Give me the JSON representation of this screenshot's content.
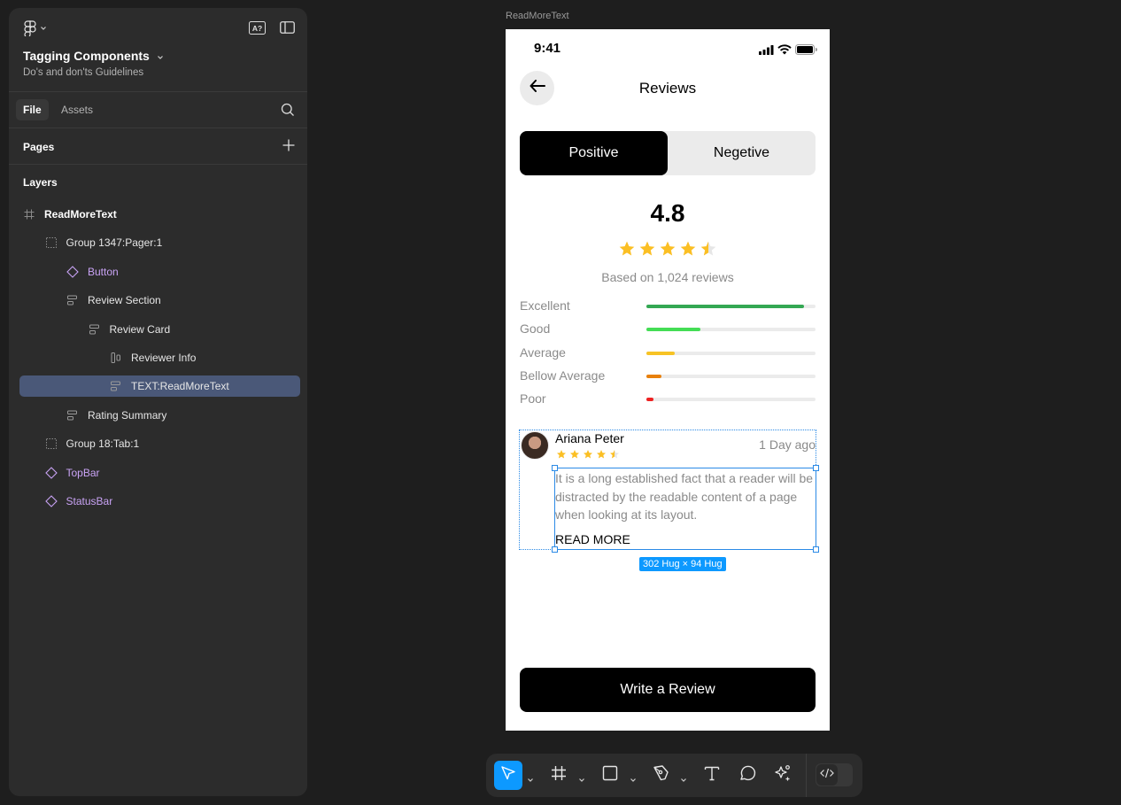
{
  "sidebar": {
    "file_title": "Tagging Components",
    "file_subtitle": "Do's and don'ts Guidelines",
    "tabs": [
      {
        "label": "File",
        "active": true
      },
      {
        "label": "Assets",
        "active": false
      }
    ],
    "pages_label": "Pages",
    "layers_label": "Layers",
    "layers": [
      {
        "label": "ReadMoreText",
        "icon": "frame-icon",
        "depth": 0,
        "type": "frame"
      },
      {
        "label": "Group 1347:Pager:1",
        "icon": "group-icon",
        "depth": 1,
        "type": "group"
      },
      {
        "label": "Button",
        "icon": "component-icon",
        "depth": 2,
        "type": "component"
      },
      {
        "label": "Review Section",
        "icon": "autolayout-vertical-icon",
        "depth": 2,
        "type": "autolayout"
      },
      {
        "label": "Review Card",
        "icon": "autolayout-vertical-icon",
        "depth": 3,
        "type": "autolayout"
      },
      {
        "label": "Reviewer Info",
        "icon": "autolayout-horizontal-icon",
        "depth": 4,
        "type": "autolayout"
      },
      {
        "label": "TEXT:ReadMoreText",
        "icon": "autolayout-vertical-icon",
        "depth": 4,
        "type": "autolayout",
        "selected": true
      },
      {
        "label": "Rating Summary",
        "icon": "autolayout-vertical-icon",
        "depth": 2,
        "type": "autolayout"
      },
      {
        "label": "Group 18:Tab:1",
        "icon": "group-icon",
        "depth": 1,
        "type": "group"
      },
      {
        "label": "TopBar",
        "icon": "component-icon",
        "depth": 1,
        "type": "component"
      },
      {
        "label": "StatusBar",
        "icon": "component-icon",
        "depth": 1,
        "type": "component"
      }
    ]
  },
  "canvas": {
    "frame_label": "ReadMoreText",
    "selection_size": "302 Hug × 94 Hug"
  },
  "phone": {
    "status_time": "9:41",
    "title": "Reviews",
    "segments": [
      {
        "label": "Positive",
        "active": true
      },
      {
        "label": "Negetive",
        "active": false
      }
    ],
    "rating": "4.8",
    "rating_stars": 4.5,
    "based_on": "Based on 1,024 reviews",
    "distribution": [
      {
        "label": "Excellent",
        "fraction": 0.93,
        "color": "#34a853"
      },
      {
        "label": "Good",
        "fraction": 0.32,
        "color": "#44dd55"
      },
      {
        "label": "Average",
        "fraction": 0.17,
        "color": "#f7c325"
      },
      {
        "label": "Bellow Average",
        "fraction": 0.09,
        "color": "#e8800c"
      },
      {
        "label": "Poor",
        "fraction": 0.04,
        "color": "#ee2222"
      }
    ],
    "review": {
      "name": "Ariana Peter",
      "time": "1 Day ago",
      "stars": 4.5,
      "text": "It is a long established fact that a reader will be distracted by the readable content of a page when looking at its layout.",
      "read_more": "READ MORE"
    },
    "write_button": "Write a Review"
  },
  "colors": {
    "star": "#fbbf24",
    "selection": "#0d99ff",
    "component": "#c9a3f5"
  },
  "toolbar": {
    "tools": [
      "move",
      "frame",
      "rectangle",
      "pen",
      "text",
      "comment",
      "actions"
    ],
    "active_tool": "move"
  }
}
